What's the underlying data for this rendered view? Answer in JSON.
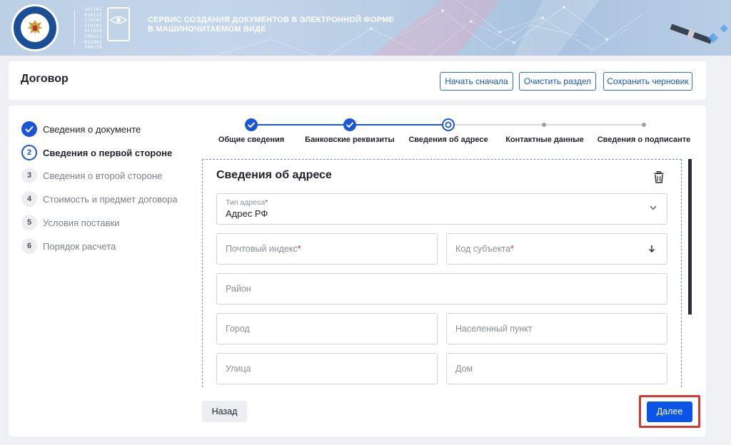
{
  "header": {
    "binary_lines": [
      "101101",
      "010110",
      "110101",
      "110101",
      "011010",
      "100111",
      "011001",
      "100110"
    ],
    "service_title_line1": "СЕРВИС СОЗДАНИЯ ДОКУМЕНТОВ В ЭЛЕКТРОННОЙ ФОРМЕ",
    "service_title_line2": "В МАШИНОЧИТАЕМОМ ВИДЕ"
  },
  "titlebar": {
    "title": "Договор",
    "buttons": {
      "restart": "Начать сначала",
      "clear": "Очистить раздел",
      "save_draft": "Сохранить черновик"
    }
  },
  "sidebar": {
    "steps": [
      {
        "num": "",
        "label": "Сведения о документе",
        "state": "done"
      },
      {
        "num": "2",
        "label": "Сведения о первой стороне",
        "state": "active"
      },
      {
        "num": "3",
        "label": "Сведения о второй стороне",
        "state": "todo"
      },
      {
        "num": "4",
        "label": "Стоимость и предмет договора",
        "state": "todo"
      },
      {
        "num": "5",
        "label": "Условия поставки",
        "state": "todo"
      },
      {
        "num": "6",
        "label": "Порядок расчета",
        "state": "todo"
      }
    ]
  },
  "stepper": {
    "steps": [
      {
        "label": "Общие сведения",
        "state": "done"
      },
      {
        "label": "Банковские реквизиты",
        "state": "done"
      },
      {
        "label": "Сведения об адресе",
        "state": "active"
      },
      {
        "label": "Контактные данные",
        "state": "todo"
      },
      {
        "label": "Сведения о подписанте",
        "state": "todo"
      }
    ]
  },
  "form": {
    "title": "Сведения об адресе",
    "address_type": {
      "label": "Тип адреса",
      "required_mark": "*",
      "value": "Адрес РФ"
    },
    "postal_code": {
      "placeholder": "Почтовый индекс",
      "required_mark": "*"
    },
    "subject_code": {
      "placeholder": "Код субъекта",
      "required_mark": "*"
    },
    "district": {
      "placeholder": "Район"
    },
    "city": {
      "placeholder": "Город"
    },
    "locality": {
      "placeholder": "Населенный пункт"
    },
    "street": {
      "placeholder": "Улица"
    },
    "house": {
      "placeholder": "Дом"
    }
  },
  "footer": {
    "back": "Назад",
    "next": "Далее"
  },
  "colors": {
    "accent": "#1a56d6",
    "highlight_frame": "#d23a2f",
    "required": "#e0242c"
  }
}
